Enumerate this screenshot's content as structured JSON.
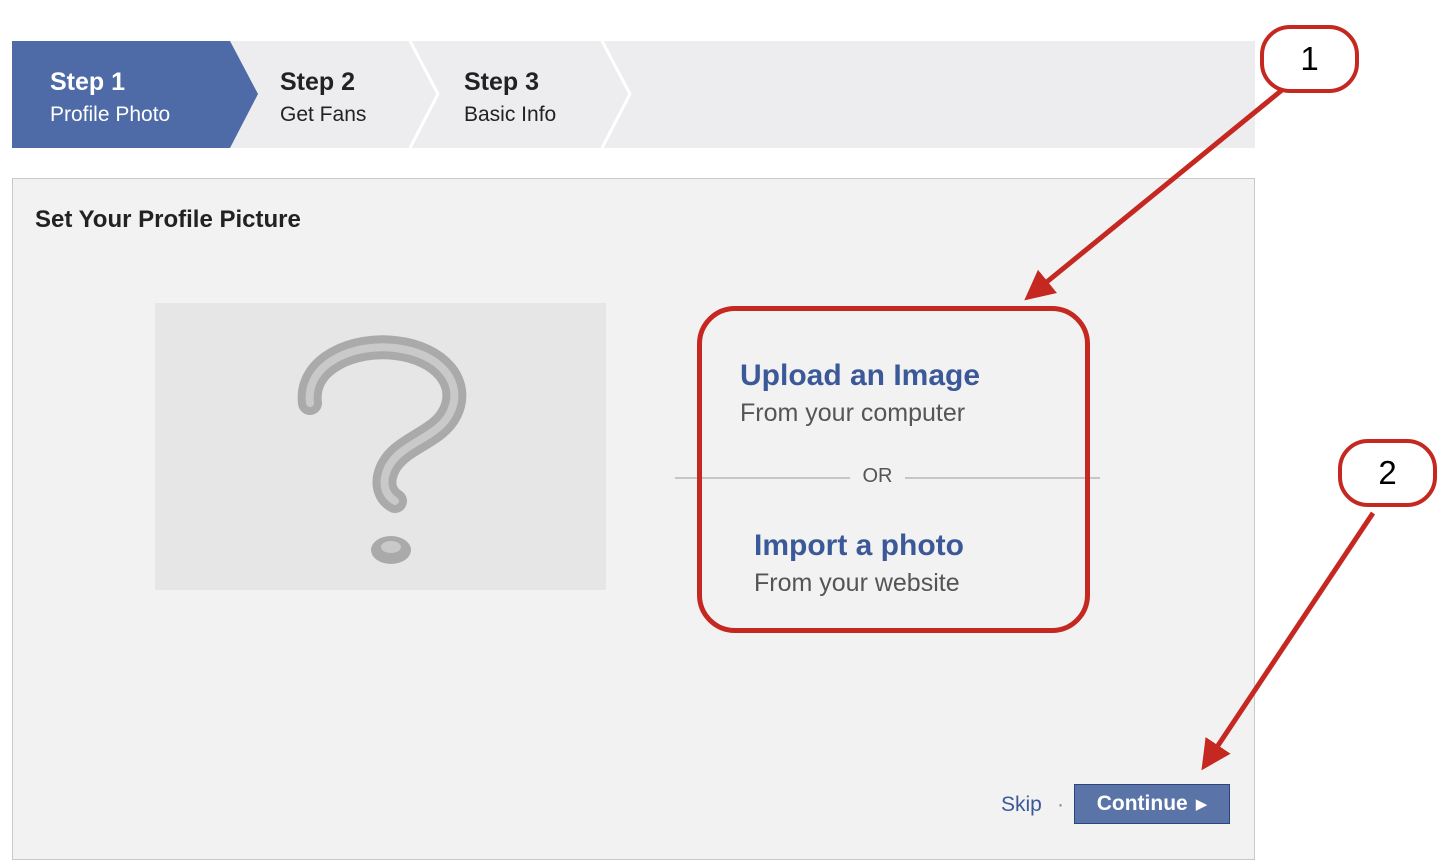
{
  "steps": [
    {
      "number": "Step 1",
      "label": "Profile Photo",
      "active": true
    },
    {
      "number": "Step 2",
      "label": "Get Fans",
      "active": false
    },
    {
      "number": "Step 3",
      "label": "Basic Info",
      "active": false
    }
  ],
  "panel": {
    "title": "Set Your Profile Picture",
    "placeholder_icon": "question-mark-icon",
    "upload": {
      "title": "Upload an Image",
      "subtitle": "From your computer"
    },
    "or_label": "OR",
    "import": {
      "title": "Import a photo",
      "subtitle": "From your website"
    },
    "skip_label": "Skip",
    "separator": "·",
    "continue_label": "Continue",
    "continue_icon": "triangle-right-icon"
  },
  "annotations": {
    "callout_1": "1",
    "callout_2": "2"
  },
  "colors": {
    "active_step": "#4e6aa7",
    "link": "#3b5998",
    "annotation": "#c42820",
    "button": "#5b74a8"
  }
}
